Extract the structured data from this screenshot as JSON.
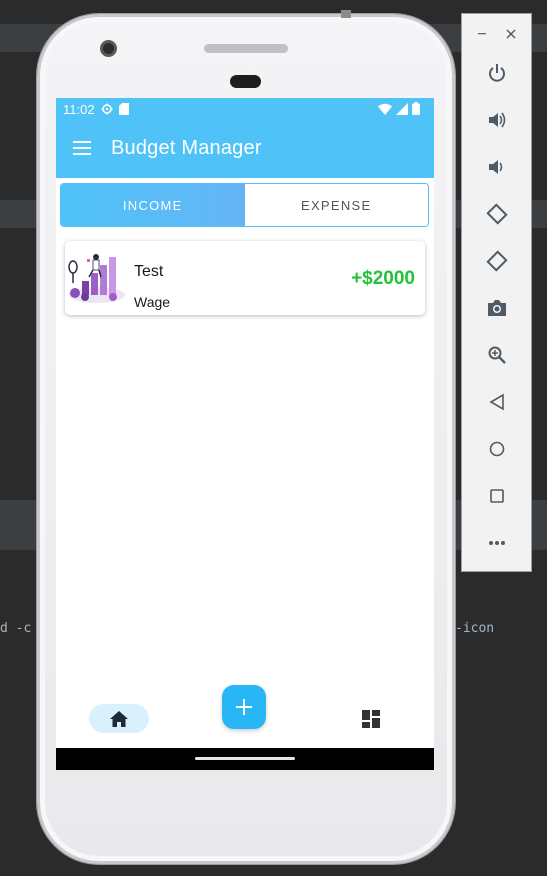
{
  "ide": {
    "left_fragment": "d -c",
    "right_fragment": "-icon"
  },
  "status_bar": {
    "time": "11:02"
  },
  "app_bar": {
    "title": "Budget Manager"
  },
  "tabs": [
    {
      "label": "INCOME",
      "active": true
    },
    {
      "label": "EXPENSE",
      "active": false
    }
  ],
  "transactions": [
    {
      "name": "Test",
      "category": "Wage",
      "amount": "+$2000",
      "amount_color": "#21c236"
    }
  ],
  "colors": {
    "primary": "#4fc3f7",
    "fab": "#29b6f6",
    "income_green": "#21c236"
  },
  "bottom_nav": {
    "items": [
      "home-icon",
      "add-icon",
      "dashboard-icon"
    ]
  },
  "emulator_toolbar": {
    "icons": [
      "minimize-icon",
      "close-icon",
      "power-icon",
      "volume-up-icon",
      "volume-down-icon",
      "rotate-left-icon",
      "rotate-right-icon",
      "camera-icon",
      "zoom-icon",
      "back-icon",
      "home-circle-icon",
      "overview-icon",
      "more-icon"
    ]
  }
}
